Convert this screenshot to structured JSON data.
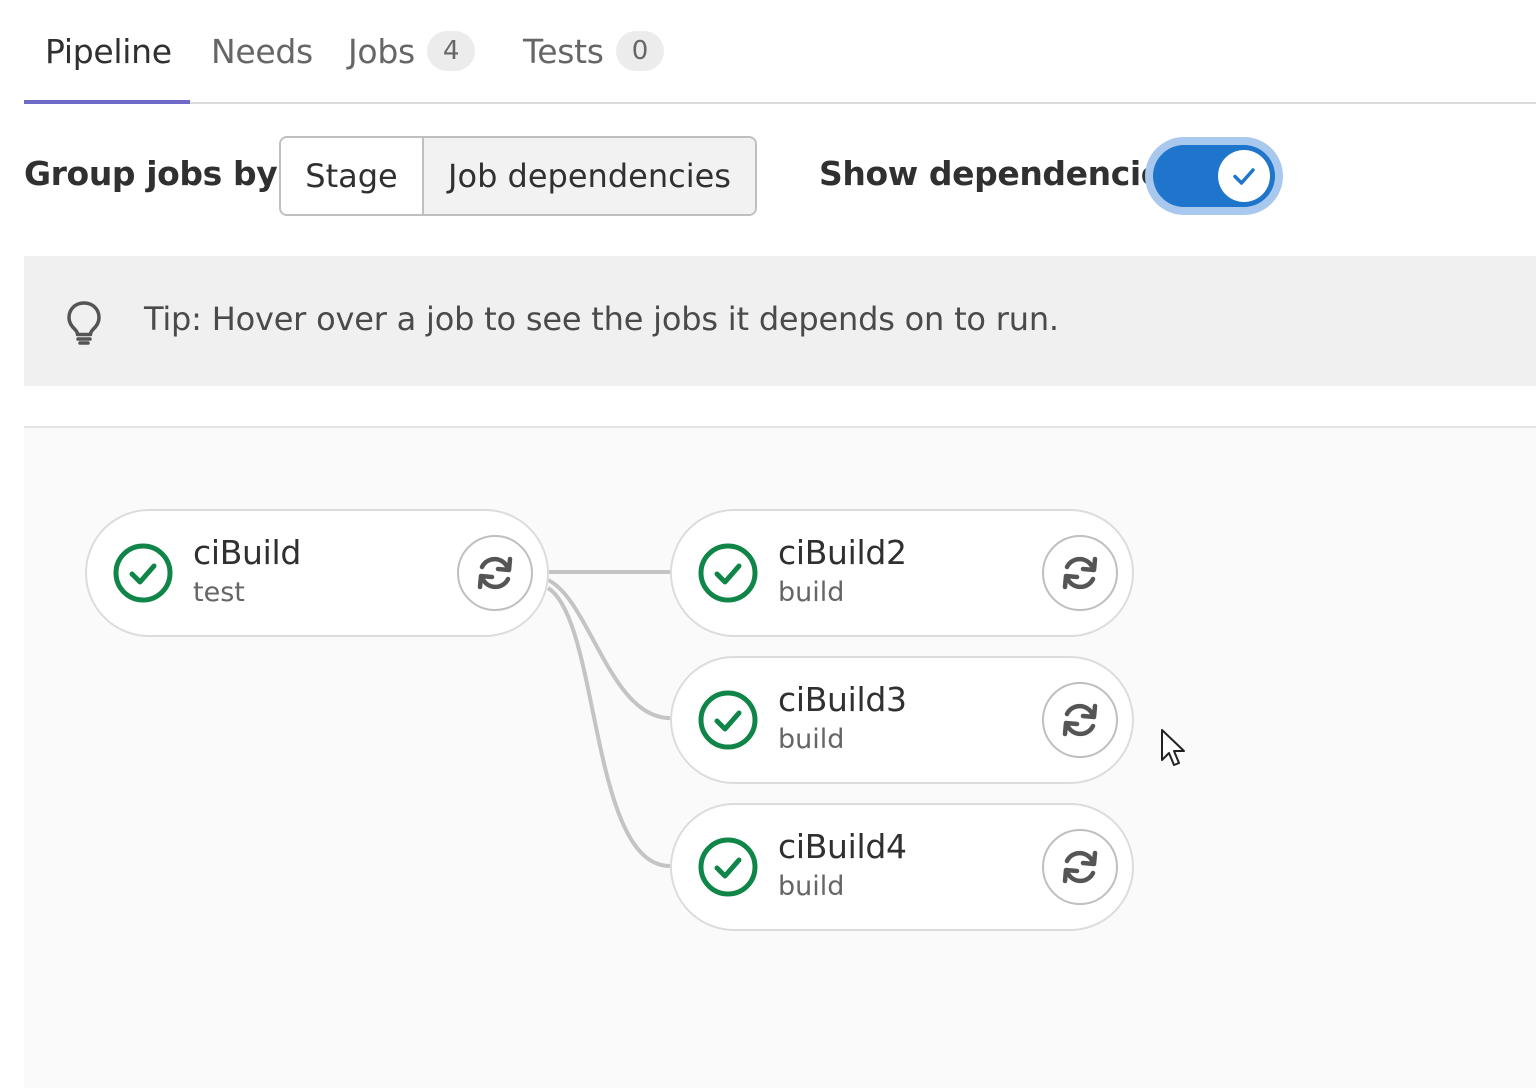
{
  "tabs": [
    {
      "label": "Pipeline",
      "count": null,
      "active": true
    },
    {
      "label": "Needs",
      "count": null,
      "active": false
    },
    {
      "label": "Jobs",
      "count": "4",
      "active": false
    },
    {
      "label": "Tests",
      "count": "0",
      "active": false
    }
  ],
  "controls": {
    "group_label": "Group jobs by",
    "options": [
      "Stage",
      "Job dependencies"
    ],
    "selected": "Job dependencies",
    "show_dependencies_label": "Show dependencies",
    "show_dependencies_on": true
  },
  "tip": {
    "icon": "lightbulb-icon",
    "text": "Tip: Hover over a job to see the jobs it depends on to run."
  },
  "jobs": [
    {
      "name": "ciBuild",
      "stage": "test",
      "status": "passed",
      "action_icon": "retry-icon"
    },
    {
      "name": "ciBuild2",
      "stage": "build",
      "status": "passed",
      "action_icon": "retry-icon"
    },
    {
      "name": "ciBuild3",
      "stage": "build",
      "status": "passed",
      "action_icon": "retry-icon"
    },
    {
      "name": "ciBuild4",
      "stage": "build",
      "status": "passed",
      "action_icon": "retry-icon"
    }
  ],
  "colors": {
    "success": "#108548",
    "toggle": "#1f75cb",
    "tab_active_underline": "#6e6ac7"
  }
}
